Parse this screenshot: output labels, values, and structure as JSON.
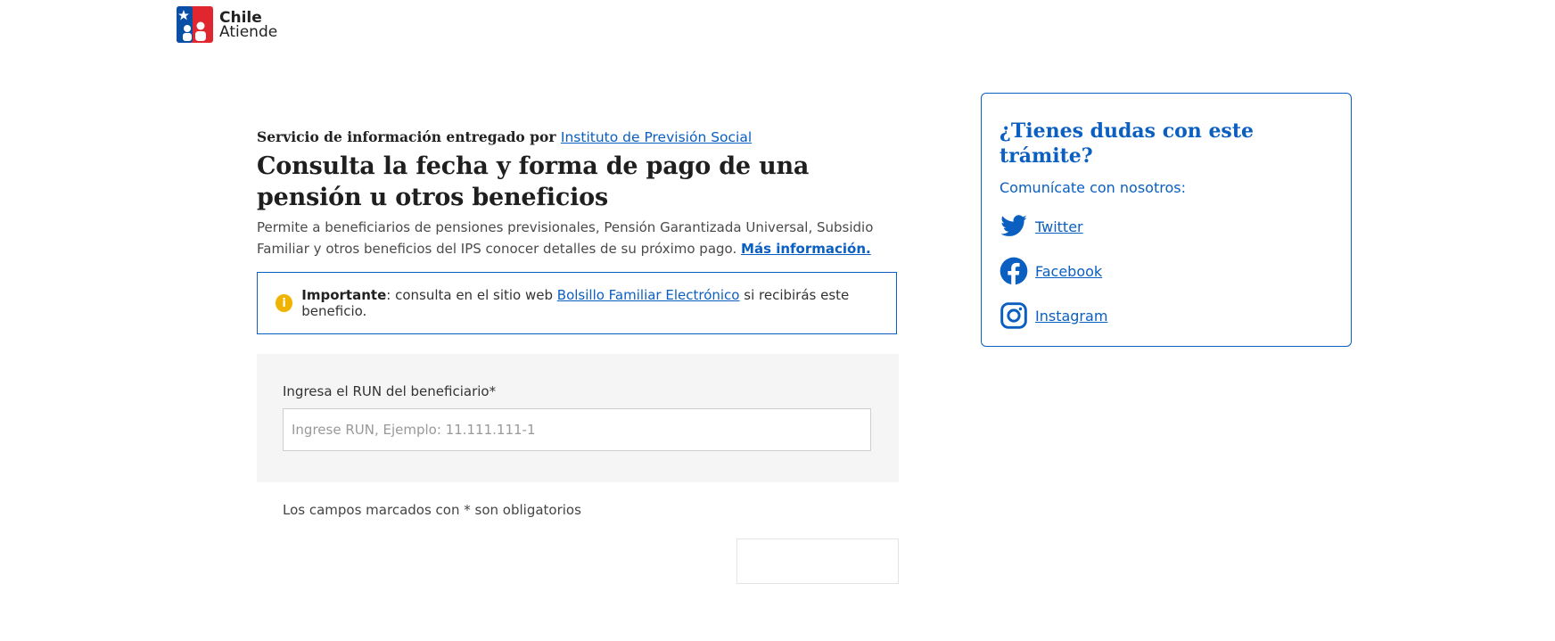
{
  "header": {
    "logo_line1": "Chile",
    "logo_line2": "Atiende"
  },
  "service": {
    "provider_prefix": "Servicio de información entregado por",
    "provider_link": "Instituto de Previsión Social",
    "title": "Consulta la fecha y forma de pago de una pensión u otros beneficios",
    "description": "Permite a beneficiarios de pensiones previsionales, Pensión Garantizada Universal, Subsidio Familiar y otros beneficios del IPS conocer detalles de su próximo pago.",
    "more_info_link": "Más información."
  },
  "notice": {
    "icon": "info-icon",
    "icon_glyph": "i",
    "strong": "Importante",
    "text_before": ": consulta en el sitio web",
    "link": "Bolsillo Familiar Electrónico",
    "text_after": "si recibirás este beneficio."
  },
  "form": {
    "run_label": "Ingresa el RUN del beneficiario*",
    "run_value": "",
    "run_placeholder": "Ingrese RUN, Ejemplo: 11.111.111-1",
    "required_note": "Los campos marcados con * son obligatorios",
    "submit_label": ""
  },
  "help": {
    "title": "¿Tienes dudas con este trámite?",
    "subtitle": "Comunícate con nosotros:",
    "links": [
      {
        "label": "Twitter",
        "icon": "twitter-icon"
      },
      {
        "label": "Facebook",
        "icon": "facebook-icon"
      },
      {
        "label": "Instagram",
        "icon": "instagram-icon"
      }
    ]
  },
  "colors": {
    "accent": "#0a5fc0",
    "warning": "#f0b400",
    "logo_blue": "#0a4fa6",
    "logo_red": "#e0262f"
  }
}
